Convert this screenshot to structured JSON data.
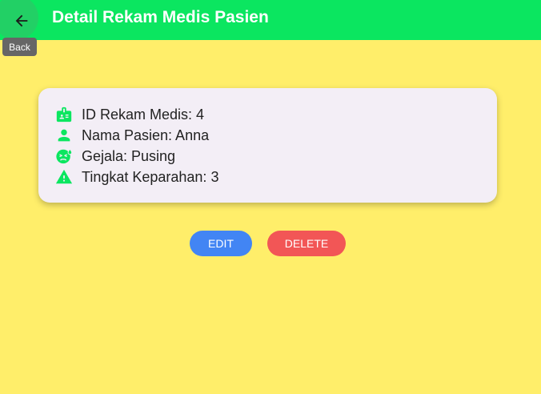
{
  "appbar": {
    "title": "Detail Rekam Medis Pasien",
    "back_tooltip": "Back",
    "color": "#0BE660"
  },
  "card": {
    "rows": [
      {
        "icon": "id-badge-icon",
        "text": "ID Rekam Medis: 4"
      },
      {
        "icon": "person-icon",
        "text": "Nama Pasien: Anna"
      },
      {
        "icon": "sick-face-icon",
        "text": "Gejala: Pusing"
      },
      {
        "icon": "warning-icon",
        "text": "Tingkat Keparahan: 3"
      }
    ]
  },
  "actions": {
    "edit_label": "EDIT",
    "delete_label": "DELETE",
    "edit_color": "#4285F4",
    "delete_color": "#F25656"
  },
  "colors": {
    "background": "#FFEE6A",
    "icon_green": "#0BE660"
  }
}
